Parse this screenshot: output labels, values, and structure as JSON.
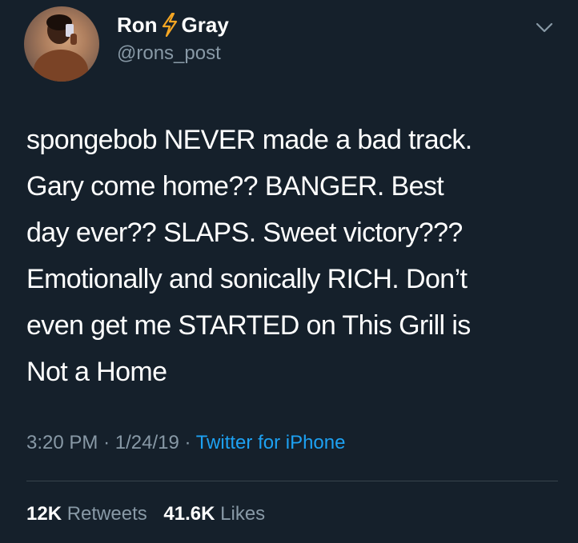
{
  "tweet": {
    "author": {
      "name_first": "Ron",
      "name_last": "Gray",
      "handle": "@rons_post",
      "name_icon": "lightning-bolt-icon",
      "avatar": "profile-photo"
    },
    "text_lines": [
      "spongebob NEVER made a bad track.",
      "Gary come home?? BANGER. Best",
      "day ever?? SLAPS. Sweet victory???",
      "Emotionally and sonically RICH. Don’t",
      "even get me STARTED on This Grill is",
      "Not a Home"
    ],
    "time": "3:20 PM",
    "date": "1/24/19",
    "separator": "·",
    "source": "Twitter for iPhone",
    "retweets_count": "12K",
    "retweets_label": "Retweets",
    "likes_count": "41.6K",
    "likes_label": "Likes",
    "menu_icon": "chevron-down-icon"
  },
  "colors": {
    "background": "#15202b",
    "primary_text": "#ffffff",
    "secondary_text": "#8899a6",
    "link": "#1da1f2",
    "divider": "#38444d",
    "bolt": "#f5a623"
  }
}
